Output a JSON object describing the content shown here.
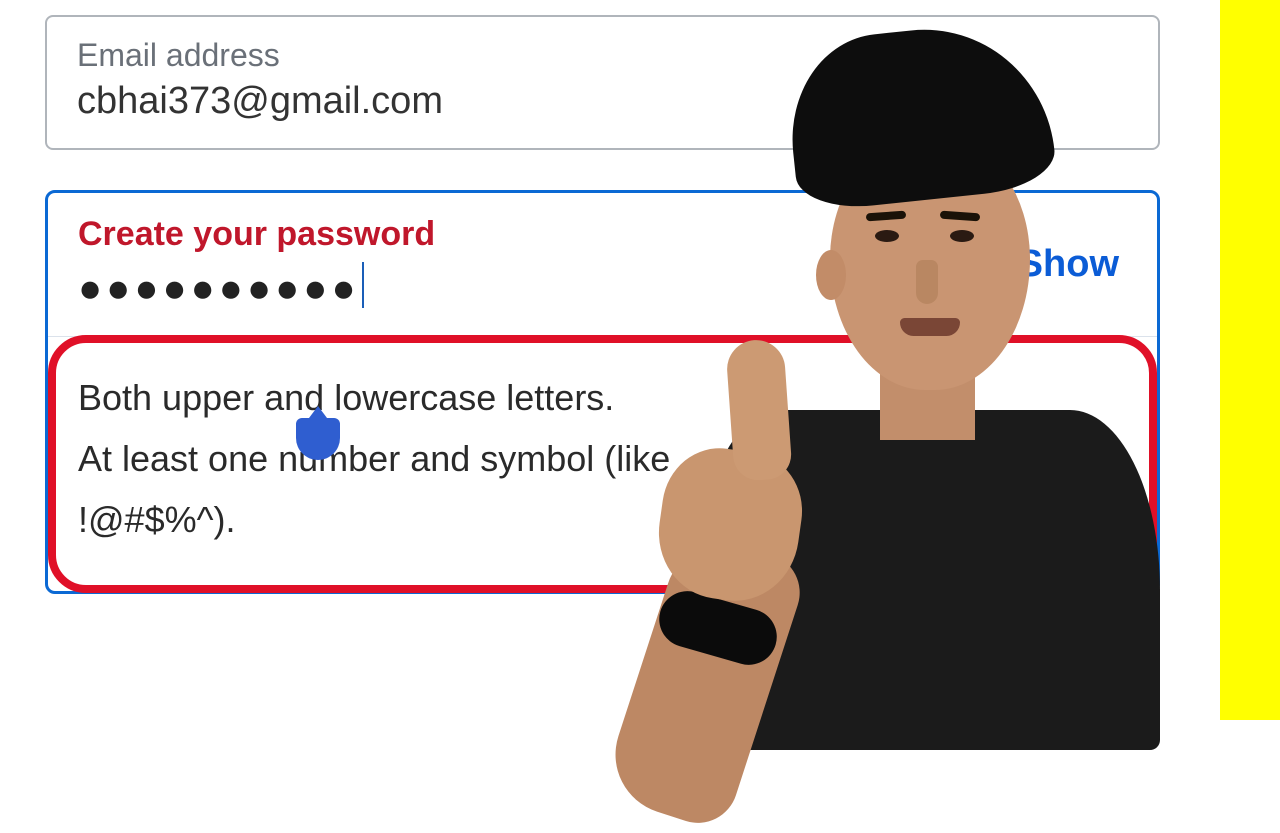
{
  "email": {
    "label": "Email address",
    "value": "cbhai373@gmail.com"
  },
  "password": {
    "label": "Create your password",
    "masked_value": "●●●●●●●●●●",
    "show_label": "Show"
  },
  "hint": {
    "line1": "Both upper and lowercase letters.",
    "line2": "At least one number and symbol (like",
    "line3": "!@#$%^)."
  }
}
